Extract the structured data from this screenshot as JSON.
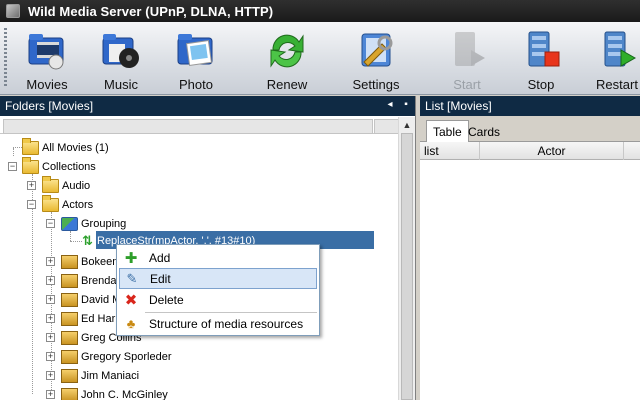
{
  "window": {
    "title": "Wild Media Server (UPnP, DLNA, HTTP)"
  },
  "toolbar": {
    "buttons": [
      {
        "label": "Movies",
        "icon": "movies-folder-icon",
        "enabled": true
      },
      {
        "label": "Music",
        "icon": "music-folder-icon",
        "enabled": true
      },
      {
        "label": "Photo",
        "icon": "photo-folder-icon",
        "enabled": true
      },
      {
        "label": "Renew",
        "icon": "renew-arrows-icon",
        "enabled": true
      },
      {
        "label": "Settings",
        "icon": "settings-wrench-icon",
        "enabled": true
      },
      {
        "label": "Start",
        "icon": "start-server-icon",
        "enabled": false
      },
      {
        "label": "Stop",
        "icon": "stop-server-icon",
        "enabled": true
      },
      {
        "label": "Restart",
        "icon": "restart-server-icon",
        "enabled": true
      }
    ]
  },
  "left_panel": {
    "title": "Folders [Movies]",
    "tree": [
      {
        "label": "All Movies (1)",
        "icon": "folder-icon"
      },
      {
        "label": "Collections",
        "icon": "folder-icon",
        "expanded": true
      },
      {
        "label": "Audio",
        "icon": "collection-folder-icon"
      },
      {
        "label": "Actors",
        "icon": "collection-folder-icon",
        "expanded": true
      },
      {
        "label": "Grouping",
        "icon": "grouping-icon",
        "expanded": true
      },
      {
        "label": "ReplaceStr(mpActor, ',', #13#10)",
        "icon": "sort-arrows-icon",
        "selected": true
      },
      {
        "label": "Bokeem Woodbine",
        "icon": "box-icon"
      },
      {
        "label": "Brendan Fraser",
        "icon": "box-icon"
      },
      {
        "label": "David Morse",
        "icon": "box-icon"
      },
      {
        "label": "Ed Harris",
        "icon": "box-icon"
      },
      {
        "label": "Greg Collins",
        "icon": "box-icon"
      },
      {
        "label": "Gregory Sporleder",
        "icon": "box-icon"
      },
      {
        "label": "Jim Maniaci",
        "icon": "box-icon"
      },
      {
        "label": "John C. McGinley",
        "icon": "box-icon"
      }
    ]
  },
  "context_menu": {
    "items": [
      {
        "label": "Add",
        "icon": "add-plus-icon",
        "highlighted": false
      },
      {
        "label": "Edit",
        "icon": "edit-icon",
        "highlighted": true
      },
      {
        "label": "Delete",
        "icon": "delete-x-icon",
        "highlighted": false
      },
      {
        "label": "Structure of media resources",
        "icon": "structure-tree-icon",
        "highlighted": false
      }
    ]
  },
  "right_panel": {
    "title": "List [Movies]",
    "tabs": [
      {
        "label": "Table",
        "active": true
      },
      {
        "label": "Cards",
        "active": false
      }
    ],
    "columns": [
      "list",
      "Actor"
    ]
  }
}
